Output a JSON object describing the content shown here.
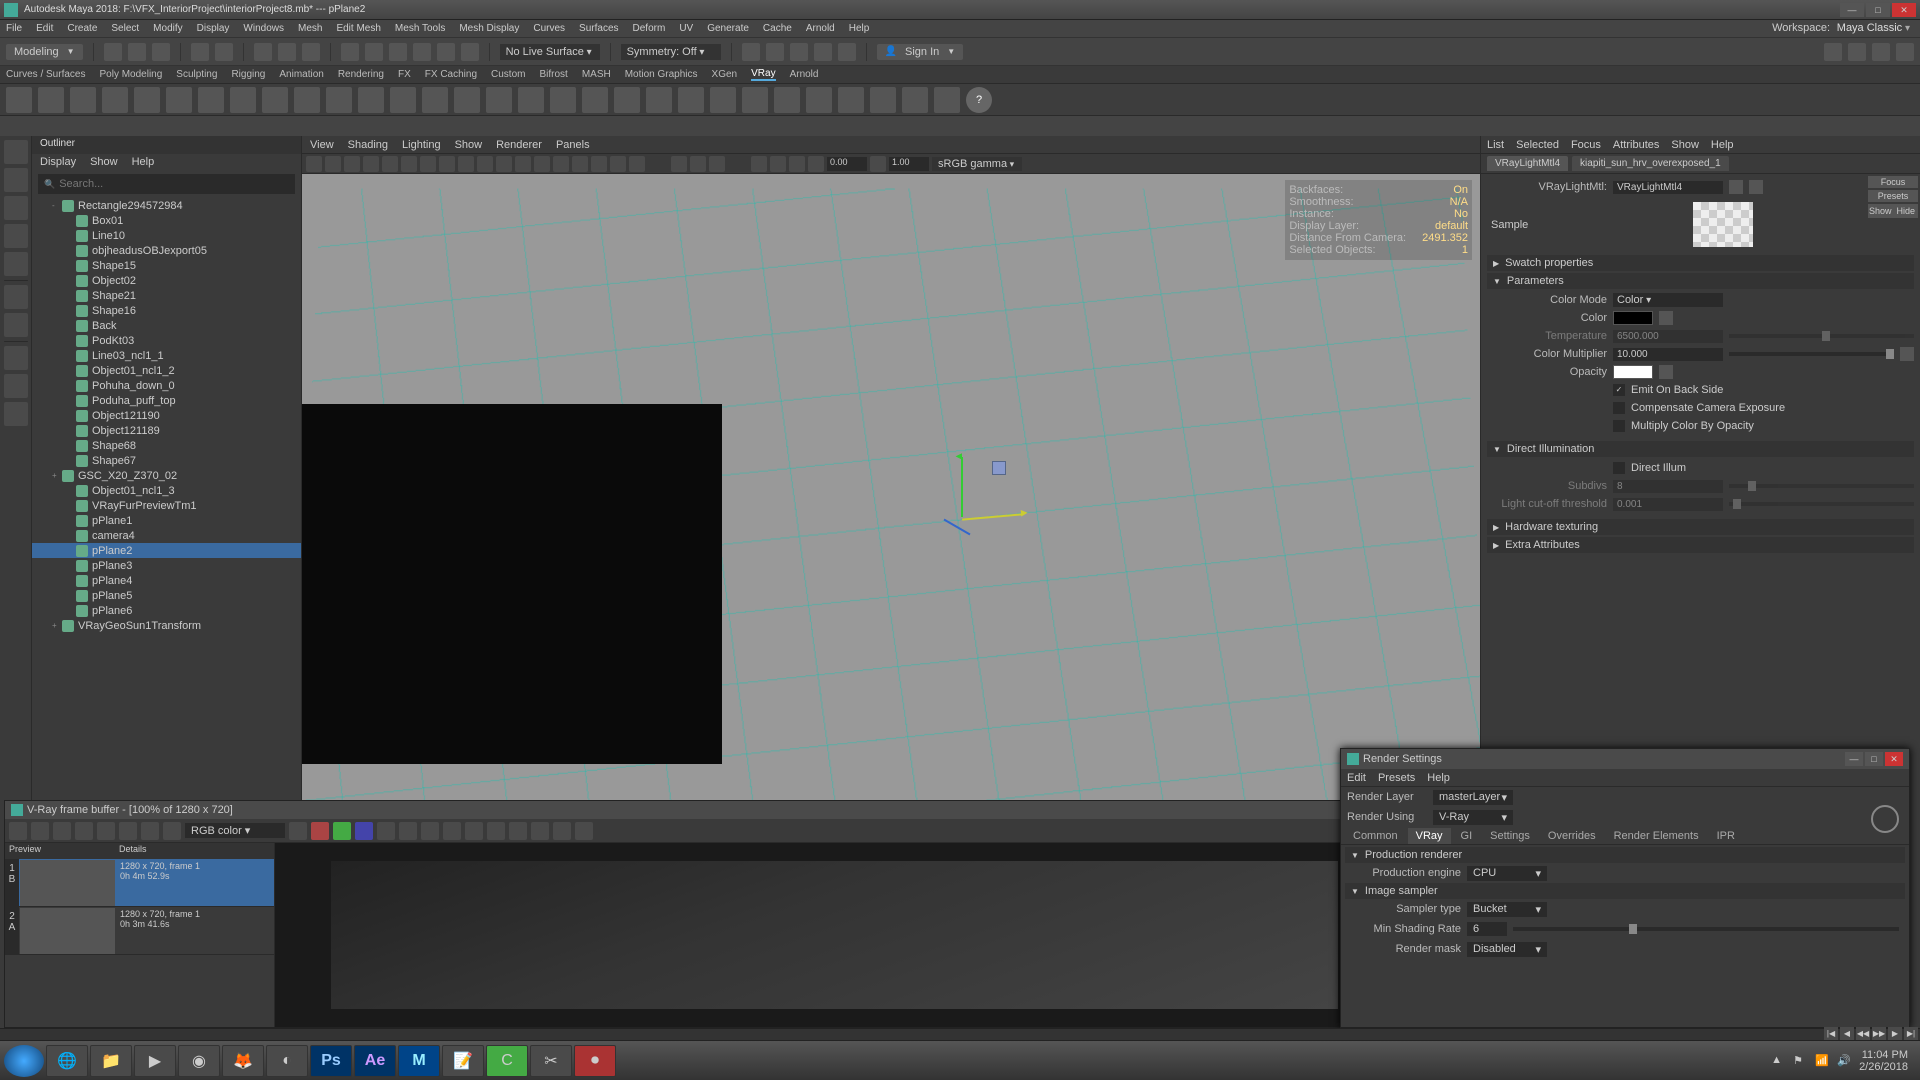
{
  "title": "Autodesk Maya 2018: F:\\VFX_InteriorProject\\interiorProject8.mb* --- pPlane2",
  "workspace": {
    "label": "Workspace:",
    "value": "Maya Classic"
  },
  "menubar": [
    "File",
    "Edit",
    "Create",
    "Select",
    "Modify",
    "Display",
    "Windows",
    "Mesh",
    "Edit Mesh",
    "Mesh Tools",
    "Mesh Display",
    "Curves",
    "Surfaces",
    "Deform",
    "UV",
    "Generate",
    "Cache",
    "Arnold",
    "Help"
  ],
  "mode_dropdown": "Modeling",
  "live_surface": "No Live Surface",
  "symmetry": "Symmetry: Off",
  "signin": "Sign In",
  "shelf_tabs": [
    "Curves / Surfaces",
    "Poly Modeling",
    "Sculpting",
    "Rigging",
    "Animation",
    "Rendering",
    "FX",
    "FX Caching",
    "Custom",
    "Bifrost",
    "MASH",
    "Motion Graphics",
    "XGen",
    "VRay",
    "Arnold"
  ],
  "shelf_active": "VRay",
  "outliner": {
    "title": "Outliner",
    "menu": [
      "Display",
      "Show",
      "Help"
    ],
    "search_placeholder": "Search...",
    "items": [
      {
        "l": "Rectangle294572984",
        "d": 1,
        "exp": "-"
      },
      {
        "l": "Box01",
        "d": 2
      },
      {
        "l": "Line10",
        "d": 2
      },
      {
        "l": "objheadusOBJexport05",
        "d": 2
      },
      {
        "l": "Shape15",
        "d": 2
      },
      {
        "l": "Object02",
        "d": 2
      },
      {
        "l": "Shape21",
        "d": 2
      },
      {
        "l": "Shape16",
        "d": 2
      },
      {
        "l": "Back",
        "d": 2
      },
      {
        "l": "PodKt03",
        "d": 2
      },
      {
        "l": "Line03_ncl1_1",
        "d": 2
      },
      {
        "l": "Object01_ncl1_2",
        "d": 2
      },
      {
        "l": "Pohuha_down_0",
        "d": 2
      },
      {
        "l": "Poduha_puff_top",
        "d": 2
      },
      {
        "l": "Object121190",
        "d": 2
      },
      {
        "l": "Object121189",
        "d": 2
      },
      {
        "l": "Shape68",
        "d": 2
      },
      {
        "l": "Shape67",
        "d": 2
      },
      {
        "l": "GSC_X20_Z370_02",
        "d": 1,
        "exp": "+"
      },
      {
        "l": "Object01_ncl1_3",
        "d": 2,
        "dim": true
      },
      {
        "l": "VRayFurPreviewTm1",
        "d": 2
      },
      {
        "l": "pPlane1",
        "d": 2
      },
      {
        "l": "camera4",
        "d": 2
      },
      {
        "l": "pPlane2",
        "d": 2,
        "sel": true
      },
      {
        "l": "pPlane3",
        "d": 2
      },
      {
        "l": "pPlane4",
        "d": 2
      },
      {
        "l": "pPlane5",
        "d": 2
      },
      {
        "l": "pPlane6",
        "d": 2,
        "dim": true
      },
      {
        "l": "VRayGeoSun1Transform",
        "d": 1,
        "exp": "+"
      }
    ]
  },
  "vp_menu": [
    "View",
    "Shading",
    "Lighting",
    "Show",
    "Renderer",
    "Panels"
  ],
  "vp_num1": "0.00",
  "vp_num2": "1.00",
  "vp_drop": "sRGB gamma",
  "hud": [
    {
      "k": "Backfaces:",
      "v": "On"
    },
    {
      "k": "Smoothness:",
      "v": "N/A"
    },
    {
      "k": "Instance:",
      "v": "No"
    },
    {
      "k": "Display Layer:",
      "v": "default"
    },
    {
      "k": "Distance From Camera:",
      "v": "2491.352"
    },
    {
      "k": "Selected Objects:",
      "v": "1"
    }
  ],
  "right_panel": {
    "tabs": [
      "List",
      "Selected",
      "Focus",
      "Attributes",
      "Show",
      "Help"
    ],
    "subtabs": [
      "VRayLightMtl4",
      "kiapiti_sun_hrv_overexposed_1"
    ],
    "subtab_active": "VRayLightMtl4",
    "side": [
      "Focus",
      "Presets",
      "Show",
      "Hide"
    ],
    "node_label": "VRayLightMtl:",
    "node_value": "VRayLightMtl4",
    "sample_label": "Sample",
    "sections": {
      "swatch": "Swatch properties",
      "params": "Parameters",
      "direct": "Direct Illumination",
      "hardware": "Hardware texturing",
      "extra": "Extra Attributes"
    },
    "params": {
      "color_mode_l": "Color Mode",
      "color_mode_v": "Color",
      "color_l": "Color",
      "temperature_l": "Temperature",
      "temperature_v": "6500.000",
      "color_mult_l": "Color Multiplier",
      "color_mult_v": "10.000",
      "opacity_l": "Opacity",
      "emit_back": "Emit On Back Side",
      "compensate": "Compensate Camera Exposure",
      "multiply_opacity": "Multiply Color By Opacity"
    },
    "direct": {
      "direct_illum": "Direct Illum",
      "subdivs_l": "Subdivs",
      "subdivs_v": "8",
      "cutoff_l": "Light cut-off threshold",
      "cutoff_v": "0.001"
    }
  },
  "vfb": {
    "title": "V-Ray frame buffer - [100% of 1280 x 720]",
    "color_channel": "RGB color",
    "hist_headers": [
      "Preview",
      "Details"
    ],
    "history": [
      {
        "letter": "B",
        "info1": "1280 x 720, frame 1",
        "info2": "0h 4m 52.9s",
        "sel": true
      },
      {
        "letter": "A",
        "info1": "1280 x 720, frame 1",
        "info2": "0h 3m 41.6s"
      }
    ]
  },
  "render_settings": {
    "title": "Render Settings",
    "menu": [
      "Edit",
      "Presets",
      "Help"
    ],
    "render_layer_l": "Render Layer",
    "render_layer_v": "masterLayer",
    "render_using_l": "Render Using",
    "render_using_v": "V-Ray",
    "tabs": [
      "Common",
      "VRay",
      "GI",
      "Settings",
      "Overrides",
      "Render Elements",
      "IPR"
    ],
    "tab_active": "VRay",
    "sections": {
      "prod": "Production renderer",
      "sampler": "Image sampler"
    },
    "prod_engine_l": "Production engine",
    "prod_engine_v": "CPU",
    "sampler_type_l": "Sampler type",
    "sampler_type_v": "Bucket",
    "min_shading_l": "Min Shading Rate",
    "min_shading_v": "6",
    "render_mask_l": "Render mask",
    "render_mask_v": "Disabled"
  },
  "taskbar": {
    "clock_time": "11:04 PM",
    "clock_date": "2/26/2018"
  }
}
